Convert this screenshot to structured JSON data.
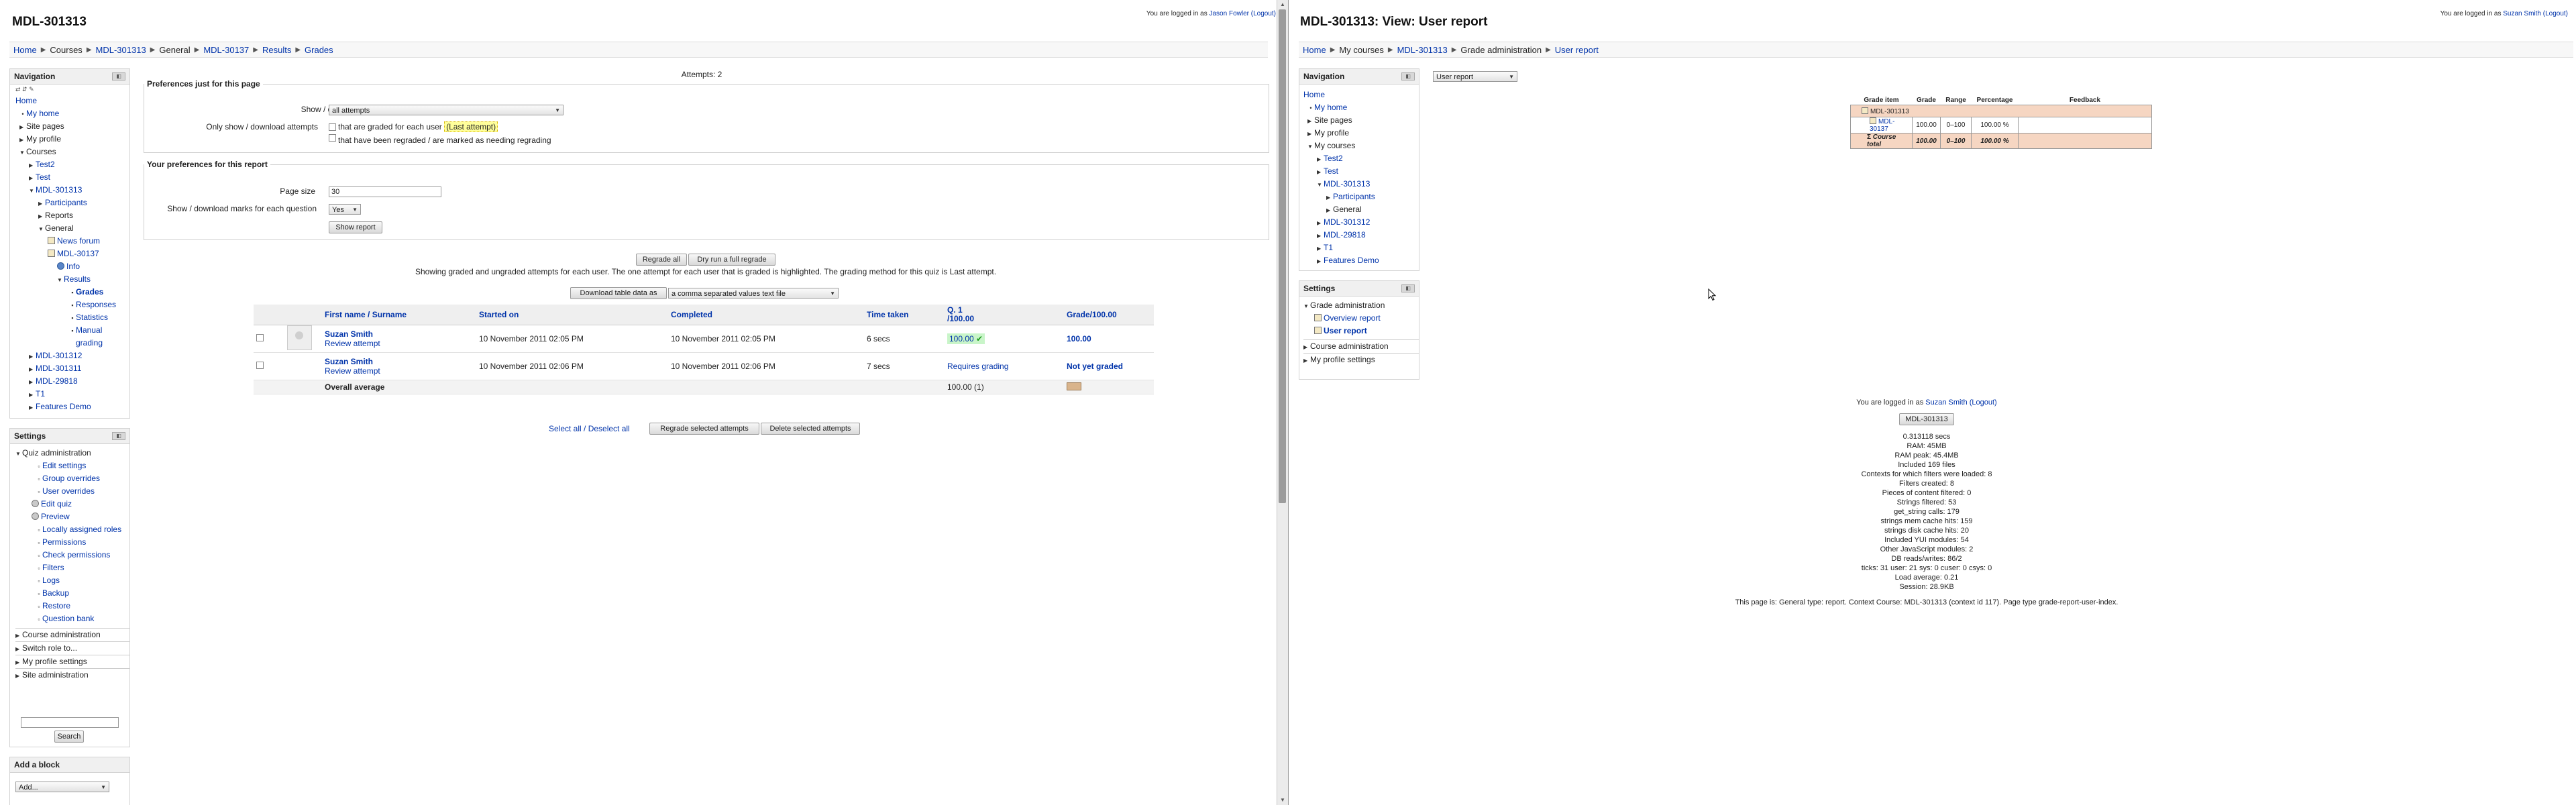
{
  "left": {
    "page_title": "MDL-301313",
    "login": {
      "prefix": "You are logged in as",
      "user": "Jason Fowler",
      "logout": "(Logout)"
    },
    "breadcrumb": [
      "Home",
      "Courses",
      "MDL-301313",
      "General",
      "MDL-30137",
      "Results",
      "Grades"
    ],
    "navigation": {
      "title": "Navigation",
      "items": {
        "home": "Home",
        "my_home": "My home",
        "site_pages": "Site pages",
        "my_profile": "My profile",
        "courses": "Courses",
        "test2": "Test2",
        "test": "Test",
        "mdl301313": "MDL-301313",
        "participants": "Participants",
        "reports": "Reports",
        "general": "General",
        "news_forum": "News forum",
        "mdl30137": "MDL-30137",
        "info": "Info",
        "results": "Results",
        "grades": "Grades",
        "responses": "Responses",
        "statistics": "Statistics",
        "manual_1": "Manual",
        "manual_2": "grading",
        "mdl301312": "MDL-301312",
        "mdl301311": "MDL-301311",
        "mdl29818": "MDL-29818",
        "t1": "T1",
        "features_demo": "Features Demo"
      }
    },
    "settings": {
      "title": "Settings",
      "quiz_admin": "Quiz administration",
      "items": [
        "Edit settings",
        "Group overrides",
        "User overrides",
        "Edit quiz",
        "Preview",
        "Locally assigned roles",
        "Permissions",
        "Check permissions",
        "Filters",
        "Logs",
        "Backup",
        "Restore",
        "Question bank"
      ],
      "course_admin": "Course administration",
      "switch_role": "Switch role to...",
      "my_profile_settings": "My profile settings",
      "site_admin": "Site administration",
      "search_button": "Search"
    },
    "add_block": {
      "title": "Add a block",
      "select": "Add..."
    },
    "attempts_header": "Attempts: 2",
    "prefs_page": {
      "legend": "Preferences just for this page",
      "show_download_label": "Show / download",
      "show_download_value": "all attempts",
      "only_show_label": "Only show / download attempts",
      "opt1_prefix": "that are graded for each user",
      "opt1_hl": "(Last attempt)",
      "opt2": "that have been regraded / are marked as needing regrading"
    },
    "prefs_user": {
      "legend": "Your preferences for this report",
      "page_size_label": "Page size",
      "page_size_value": "30",
      "marks_label": "Show / download marks for each question",
      "marks_value": "Yes",
      "show_report": "Show report"
    },
    "regrade_all": "Regrade all",
    "dry_run": "Dry run a full regrade",
    "info_text": "Showing graded and ungraded attempts for each user. The one attempt for each user that is graded is highlighted. The grading method for this quiz is Last attempt.",
    "download_button": "Download table data as",
    "download_format": "a comma separated values text file",
    "table": {
      "headers": [
        "First name / Surname",
        "Started on",
        "Completed",
        "Time taken",
        "Q. 1",
        "/100.00",
        "Grade/100.00"
      ],
      "rows": [
        {
          "name": "Suzan Smith",
          "review": "Review attempt",
          "started": "10 November 2011 02:05 PM",
          "completed": "10 November 2011 02:05 PM",
          "time": "6 secs",
          "q1": "100.00",
          "grade": "100.00"
        },
        {
          "name": "Suzan Smith",
          "review": "Review attempt",
          "started": "10 November 2011 02:06 PM",
          "completed": "10 November 2011 02:06 PM",
          "time": "7 secs",
          "q1": "Requires grading",
          "grade": "Not yet graded"
        }
      ],
      "avg_label": "Overall average",
      "avg_q1": "100.00 (1)"
    },
    "select_all": "Select all / Deselect all",
    "regrade_selected": "Regrade selected attempts",
    "delete_selected": "Delete selected attempts"
  },
  "right": {
    "page_title": "MDL-301313: View: User report",
    "login": {
      "prefix": "You are logged in as",
      "user": "Suzan Smith",
      "logout": "(Logout)"
    },
    "breadcrumb": [
      "Home",
      "My courses",
      "MDL-301313",
      "Grade administration",
      "User report"
    ],
    "report_select": "User report",
    "navigation": {
      "title": "Navigation",
      "items": {
        "home": "Home",
        "my_home": "My home",
        "site_pages": "Site pages",
        "my_profile": "My profile",
        "my_courses": "My courses",
        "test2": "Test2",
        "test": "Test",
        "mdl301313": "MDL-301313",
        "participants": "Participants",
        "general": "General",
        "mdl301312": "MDL-301312",
        "mdl29818": "MDL-29818",
        "t1": "T1",
        "features_demo": "Features Demo"
      }
    },
    "settings": {
      "title": "Settings",
      "grade_admin": "Grade administration",
      "overview_report": "Overview report",
      "user_report": "User report",
      "course_admin": "Course administration",
      "my_profile_settings": "My profile settings"
    },
    "grade_table": {
      "headers": [
        "Grade item",
        "Grade",
        "Range",
        "Percentage",
        "Feedback"
      ],
      "category": "MDL-301313",
      "item": {
        "name": "MDL-30137",
        "grade": "100.00",
        "range": "0–100",
        "pct": "100.00 %"
      },
      "total": {
        "name": "Course total",
        "grade": "100.00",
        "range": "0–100",
        "pct": "100.00 %"
      }
    },
    "footer": {
      "login_prefix": "You are logged in as",
      "user": "Suzan Smith",
      "logout": "(Logout)",
      "course_button": "MDL-301313",
      "perf": [
        "0.313118 secs",
        "RAM: 45MB",
        "RAM peak: 45.4MB",
        "Included 169 files",
        "Contexts for which filters were loaded: 8",
        "Filters created: 8",
        "Pieces of content filtered: 0",
        "Strings filtered: 53",
        "get_string calls: 179",
        "strings mem cache hits: 159",
        "strings disk cache hits: 20",
        "Included YUI modules: 54",
        "Other JavaScript modules: 2",
        "DB reads/writes: 86/2",
        "ticks: 31 user: 21 sys: 0 cuser: 0 csys: 0",
        "Load average: 0.21",
        "Session: 28.9KB"
      ],
      "page_info": "This page is: General type: report. Context Course: MDL-301313 (context id 117). Page type grade-report-user-index."
    }
  }
}
